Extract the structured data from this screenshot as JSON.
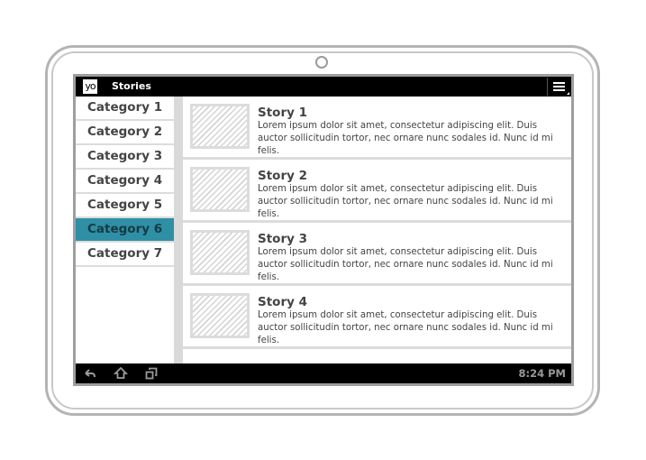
{
  "app": {
    "logo_text": "yo",
    "title": "Stories"
  },
  "categories": [
    {
      "label": "Category 1",
      "active": false
    },
    {
      "label": "Category 2",
      "active": false
    },
    {
      "label": "Category 3",
      "active": false
    },
    {
      "label": "Category 4",
      "active": false
    },
    {
      "label": "Category 5",
      "active": false
    },
    {
      "label": "Category 6",
      "active": true
    },
    {
      "label": "Category 7",
      "active": false
    }
  ],
  "stories": [
    {
      "title": "Story 1",
      "body": "Lorem ipsum dolor sit amet, consectetur adipiscing elit. Duis auctor sollicitudin tortor, nec ornare nunc sodales id. Nunc id mi felis."
    },
    {
      "title": "Story 2",
      "body": "Lorem ipsum dolor sit amet, consectetur adipiscing elit. Duis auctor sollicitudin tortor, nec ornare nunc sodales id. Nunc id mi felis."
    },
    {
      "title": "Story 3",
      "body": "Lorem ipsum dolor sit amet, consectetur adipiscing elit. Duis auctor sollicitudin tortor, nec ornare nunc sodales id. Nunc id mi felis."
    },
    {
      "title": "Story 4",
      "body": "Lorem ipsum dolor sit amet, consectetur adipiscing elit. Duis auctor sollicitudin tortor, nec ornare nunc sodales id. Nunc id mi felis."
    }
  ],
  "system_bar": {
    "icons": [
      "back-icon",
      "home-icon",
      "recent-apps-icon"
    ],
    "time": "8:24 PM"
  },
  "colors": {
    "active_category": "#2f8fa5",
    "bar_background": "#000000"
  }
}
